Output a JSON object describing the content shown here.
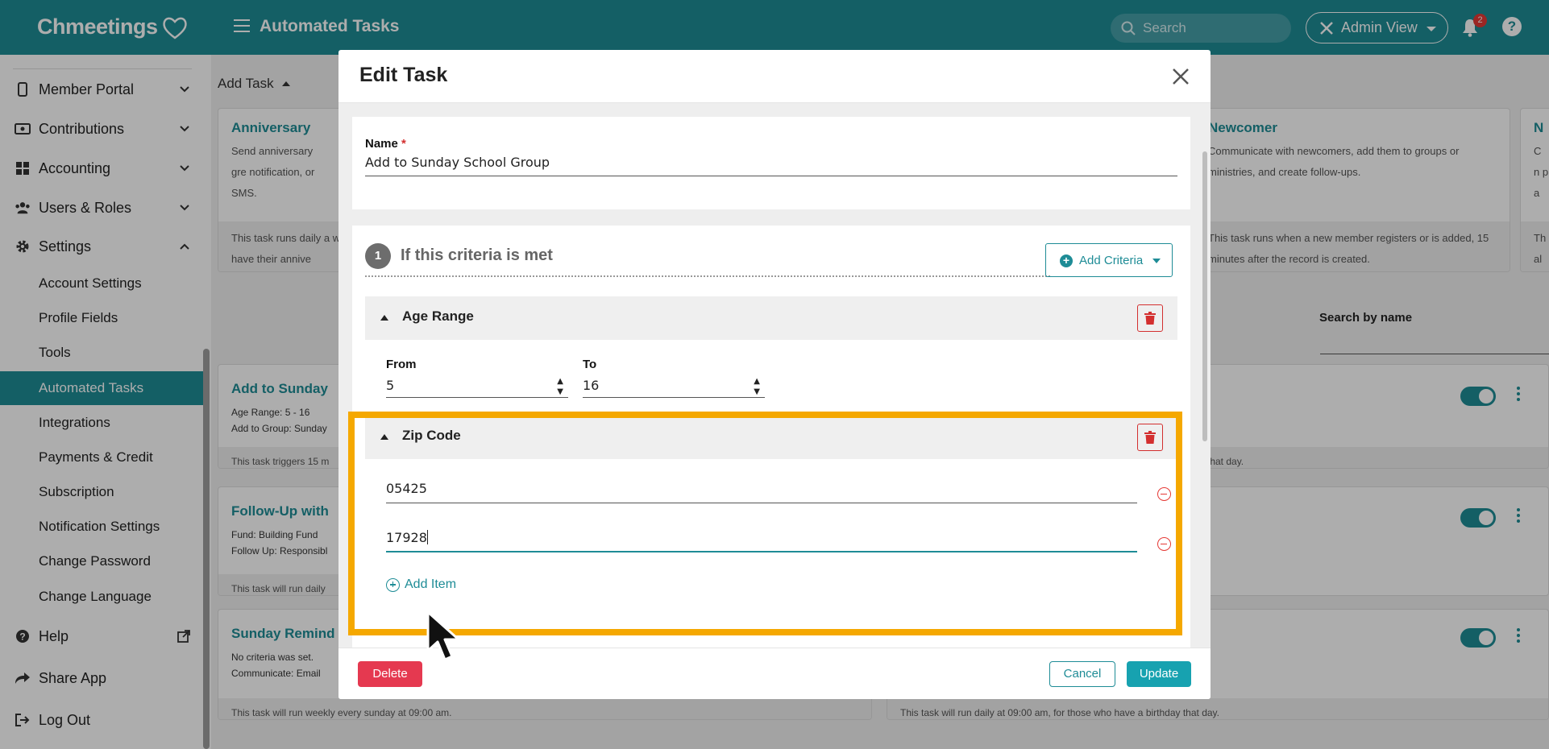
{
  "app": {
    "name": "Chmeetings",
    "page_title": "Automated Tasks",
    "accent_color": "#1e8c96"
  },
  "topbar": {
    "search_placeholder": "Search",
    "admin_view_label": "Admin View",
    "notification_count": "2",
    "help_label": "?"
  },
  "sidebar": {
    "items": [
      {
        "label": "Member Portal",
        "icon": "phone-icon"
      },
      {
        "label": "Contributions",
        "icon": "cash-icon"
      },
      {
        "label": "Accounting",
        "icon": "grid-icon"
      },
      {
        "label": "Users & Roles",
        "icon": "users-icon"
      },
      {
        "label": "Settings",
        "icon": "gear-icon"
      }
    ],
    "settings_sub": [
      "Account Settings",
      "Profile Fields",
      "Tools",
      "Automated Tasks",
      "Integrations",
      "Payments & Credit",
      "Subscription",
      "Notification Settings",
      "Change Password",
      "Change Language"
    ],
    "bottom": [
      {
        "label": "Help",
        "icon": "help-icon"
      },
      {
        "label": "Share App",
        "icon": "share-icon"
      },
      {
        "label": "Log Out",
        "icon": "logout-icon"
      }
    ]
  },
  "background": {
    "add_task_label": "Add Task",
    "templates": [
      {
        "title": "Anniversary",
        "desc": "Send anniversary gre notification, or SMS.",
        "footer": "This task runs daily a who have their annive"
      },
      {
        "title": "Newcomer",
        "desc": "Communicate with newcomers, add them to groups or ministries, and create follow-ups.",
        "footer": "This task runs when a new member registers or is added, 15 minutes after the record is created."
      },
      {
        "title": "N",
        "desc": "C n p a",
        "footer": "Th al"
      }
    ],
    "search_by_name_label": "Search by name",
    "tasks": [
      {
        "title": "Add to Sunday",
        "d1": "Age Range: 5 - 16",
        "d2": "Add to Group: Sunday",
        "footer": "This task triggers 15 m",
        "right_footer": "that day."
      },
      {
        "title": "Follow-Up with",
        "d1": "Fund: Building Fund",
        "d2": "Follow Up: Responsibl",
        "footer": "This task will run daily",
        "right_footer": ""
      },
      {
        "title": "Sunday Remind",
        "d1": "No criteria was set.",
        "d2": "Communicate: Email",
        "footer": "This task will run weekly every sunday at 09:00 am.",
        "right_footer": "This task will run daily at 09:00 am, for those who have a birthday that day."
      }
    ]
  },
  "modal": {
    "title": "Edit Task",
    "name_label": "Name",
    "name_required": "*",
    "name_value": "Add to Sunday School Group",
    "step_number": "1",
    "step_title": "If this criteria is met",
    "add_criteria_label": "Add Criteria",
    "age_range": {
      "title": "Age Range",
      "from_label": "From",
      "from_value": "5",
      "to_label": "To",
      "to_value": "16"
    },
    "zip_code": {
      "title": "Zip Code",
      "items": [
        "05425",
        "17928"
      ],
      "add_item_label": "Add Item"
    },
    "buttons": {
      "delete": "Delete",
      "cancel": "Cancel",
      "update": "Update"
    }
  }
}
